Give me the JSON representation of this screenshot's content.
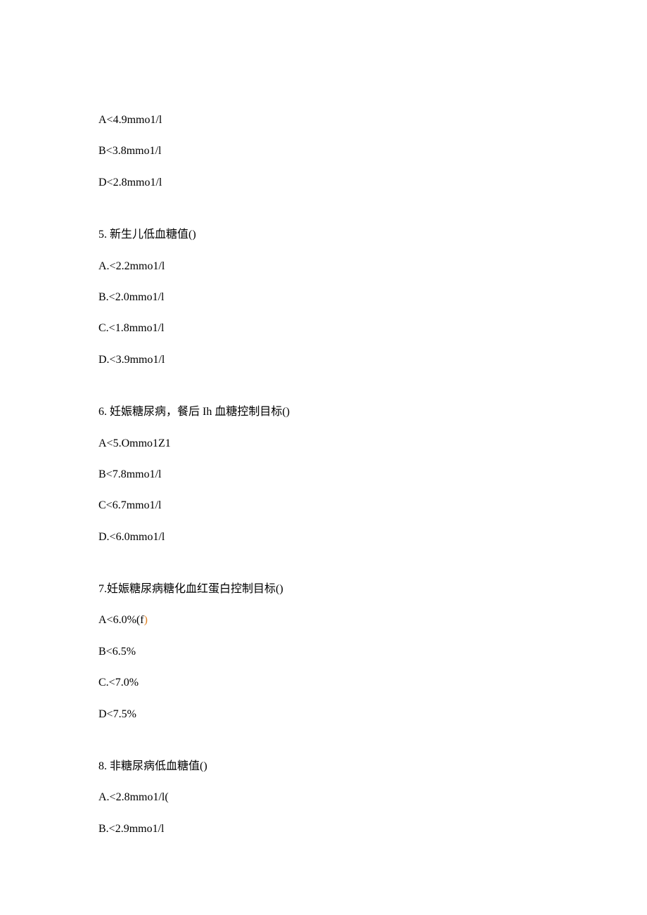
{
  "block1": {
    "optA": "A<4.9mmo1/l",
    "optB": "B<3.8mmo1/l",
    "optD": "D<2.8mmo1/l"
  },
  "q5": {
    "num": "5",
    "sep": ". ",
    "text": "新生儿低血糖值()",
    "optA": "A.<2.2mmo1/l",
    "optB": "B.<2.0mmo1/l",
    "optC": "C.<1.8mmo1/l",
    "optD": "D.<3.9mmo1/l"
  },
  "q6": {
    "num": "6",
    "sep": ". ",
    "text": "妊娠糖尿病，餐后 Ih 血糖控制目标()",
    "optA": "A<5.Ommo1Z1",
    "optB": "B<7.8mmo1/l",
    "optC": "C<6.7mmo1/l",
    "optD": "D.<6.0mmo1/l"
  },
  "q7": {
    "num": "7",
    "sep": ".",
    "text": "妊娠糖尿病糖化血红蛋白控制目标()",
    "optA_pre": "A<6.0%(f",
    "optA_suf": ")",
    "optB": "B<6.5%",
    "optC": "C.<7.0%",
    "optD": "D<7.5%"
  },
  "q8": {
    "num": "8",
    "sep": ". ",
    "text": "非糖尿病低血糖值()",
    "optA": "A.<2.8mmo1/l(",
    "optB": "B.<2.9mmo1/l"
  }
}
